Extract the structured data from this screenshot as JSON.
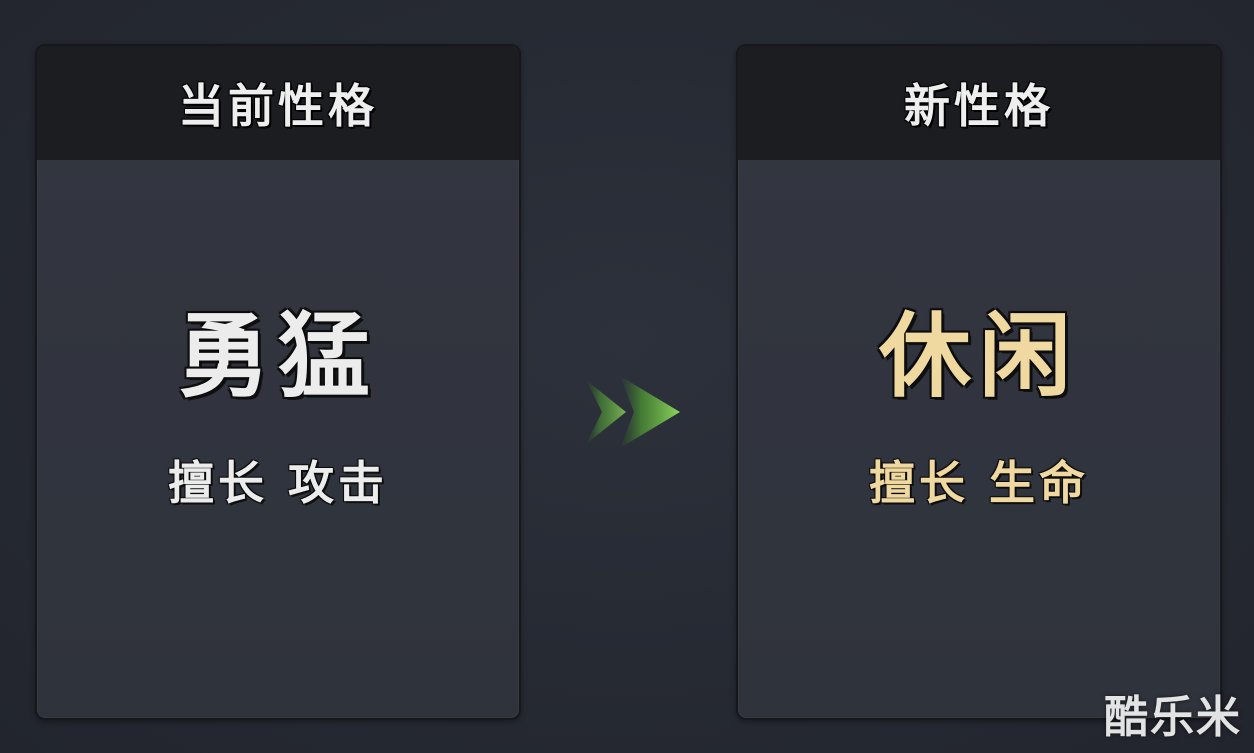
{
  "current_panel": {
    "header": "当前性格",
    "trait": "勇猛",
    "specialty": "擅长 攻击",
    "text_color": "#ececec"
  },
  "new_panel": {
    "header": "新性格",
    "trait": "休闲",
    "specialty": "擅长 生命",
    "text_color": "#f0d9a0"
  },
  "arrow": {
    "icon": "double-chevron-right-icon",
    "color": "#6fbf4a"
  },
  "watermark": "酷乐米"
}
